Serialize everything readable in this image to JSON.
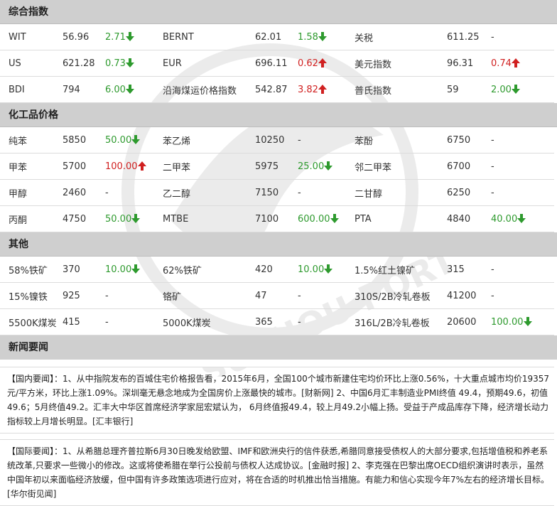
{
  "sections": {
    "composite": "综合指数",
    "chemical": "化工品价格",
    "other": "其他",
    "news": "新闻要闻"
  },
  "composite_rows": [
    [
      {
        "name": "WIT",
        "price": "56.96",
        "change": "2.71",
        "dir": "down"
      },
      {
        "name": "BERNT",
        "price": "62.01",
        "change": "1.58",
        "dir": "down"
      },
      {
        "name": "关税",
        "price": "611.25",
        "change": "-",
        "dir": "none"
      }
    ],
    [
      {
        "name": "US",
        "price": "621.28",
        "change": "0.73",
        "dir": "down"
      },
      {
        "name": "EUR",
        "price": "696.11",
        "change": "0.62",
        "dir": "up"
      },
      {
        "name": "美元指数",
        "price": "96.31",
        "change": "0.74",
        "dir": "up"
      }
    ],
    [
      {
        "name": "BDI",
        "price": "794",
        "change": "6.00",
        "dir": "down"
      },
      {
        "name": "沿海煤运价格指数",
        "price": "542.87",
        "change": "3.82",
        "dir": "up"
      },
      {
        "name": "普氏指数",
        "price": "59",
        "change": "2.00",
        "dir": "down"
      }
    ]
  ],
  "chemical_rows": [
    [
      {
        "name": "纯苯",
        "price": "5850",
        "change": "50.00",
        "dir": "down"
      },
      {
        "name": "苯乙烯",
        "price": "10250",
        "change": "-",
        "dir": "none"
      },
      {
        "name": "苯酚",
        "price": "6750",
        "change": "-",
        "dir": "none"
      }
    ],
    [
      {
        "name": "甲苯",
        "price": "5700",
        "change": "100.00",
        "dir": "up"
      },
      {
        "name": "二甲苯",
        "price": "5975",
        "change": "25.00",
        "dir": "down"
      },
      {
        "name": "邻二甲苯",
        "price": "6700",
        "change": "-",
        "dir": "none"
      }
    ],
    [
      {
        "name": "甲醇",
        "price": "2460",
        "change": "-",
        "dir": "none"
      },
      {
        "name": "乙二醇",
        "price": "7150",
        "change": "-",
        "dir": "none"
      },
      {
        "name": "二甘醇",
        "price": "6250",
        "change": "-",
        "dir": "none"
      }
    ],
    [
      {
        "name": "丙酮",
        "price": "4750",
        "change": "50.00",
        "dir": "down"
      },
      {
        "name": "MTBE",
        "price": "7100",
        "change": "600.00",
        "dir": "down"
      },
      {
        "name": "PTA",
        "price": "4840",
        "change": "40.00",
        "dir": "down"
      }
    ]
  ],
  "other_rows": [
    [
      {
        "name": "58%铁矿",
        "price": "370",
        "change": "10.00",
        "dir": "down"
      },
      {
        "name": "62%铁矿",
        "price": "420",
        "change": "10.00",
        "dir": "down"
      },
      {
        "name": "1.5%红土镍矿",
        "price": "315",
        "change": "-",
        "dir": "none"
      }
    ],
    [
      {
        "name": "15%镍铁",
        "price": "925",
        "change": "-",
        "dir": "none"
      },
      {
        "name": "铬矿",
        "price": "47",
        "change": "-",
        "dir": "none"
      },
      {
        "name": "310S/2B冷轧卷板",
        "price": "41200",
        "change": "-",
        "dir": "none"
      }
    ],
    [
      {
        "name": "5500K煤炭",
        "price": "415",
        "change": "-",
        "dir": "none"
      },
      {
        "name": "5000K煤炭",
        "price": "365",
        "change": "-",
        "dir": "none"
      },
      {
        "name": "316L/2B冷轧卷板",
        "price": "20600",
        "change": "100.00",
        "dir": "down"
      }
    ]
  ],
  "news": {
    "domestic": "【国内要闻】：1、从中指院发布的百城住宅价格报告看，2015年6月，全国100个城市新建住宅均价环比上涨0.56%，十大重点城市均价19357元/平方米，环比上涨1.09%。深圳毫无悬念地成为全国房价上涨最快的城市。[财新网] 2、中国6月汇丰制造业PMI终值 49.4，预期49.6，初值49.6；5月终值49.2。汇丰大中华区首席经济学家屈宏斌认为， 6月终值报49.4，较上月49.2小幅上扬。受益于产成品库存下降，经济增长动力指标较上月增长明显。[汇丰银行]",
    "international": "【国际要闻】：1、从希腊总理齐普拉斯6月30日晚发给欧盟、IMF和欧洲央行的信件获悉,希腊同意接受债权人的大部分要求,包括增值税和养老系统改革,只要求一些微小的修改。这或将使希腊在举行公投前与债权人达成协议。[金融时报] 2、李克强在巴黎出席OECD组织演讲时表示，虽然中国年初以来面临经济放缓，但中国有许多政策选项进行应对，将在合适的时机推出恰当措施。有能力和信心实现今年7%左右的经济增长目标。[华尔街见闻]"
  },
  "watermark_text": "SUZHOU PORT",
  "colors": {
    "up": "#d02020",
    "down": "#2e9a2e",
    "header_bg": "#cfcfcf"
  }
}
